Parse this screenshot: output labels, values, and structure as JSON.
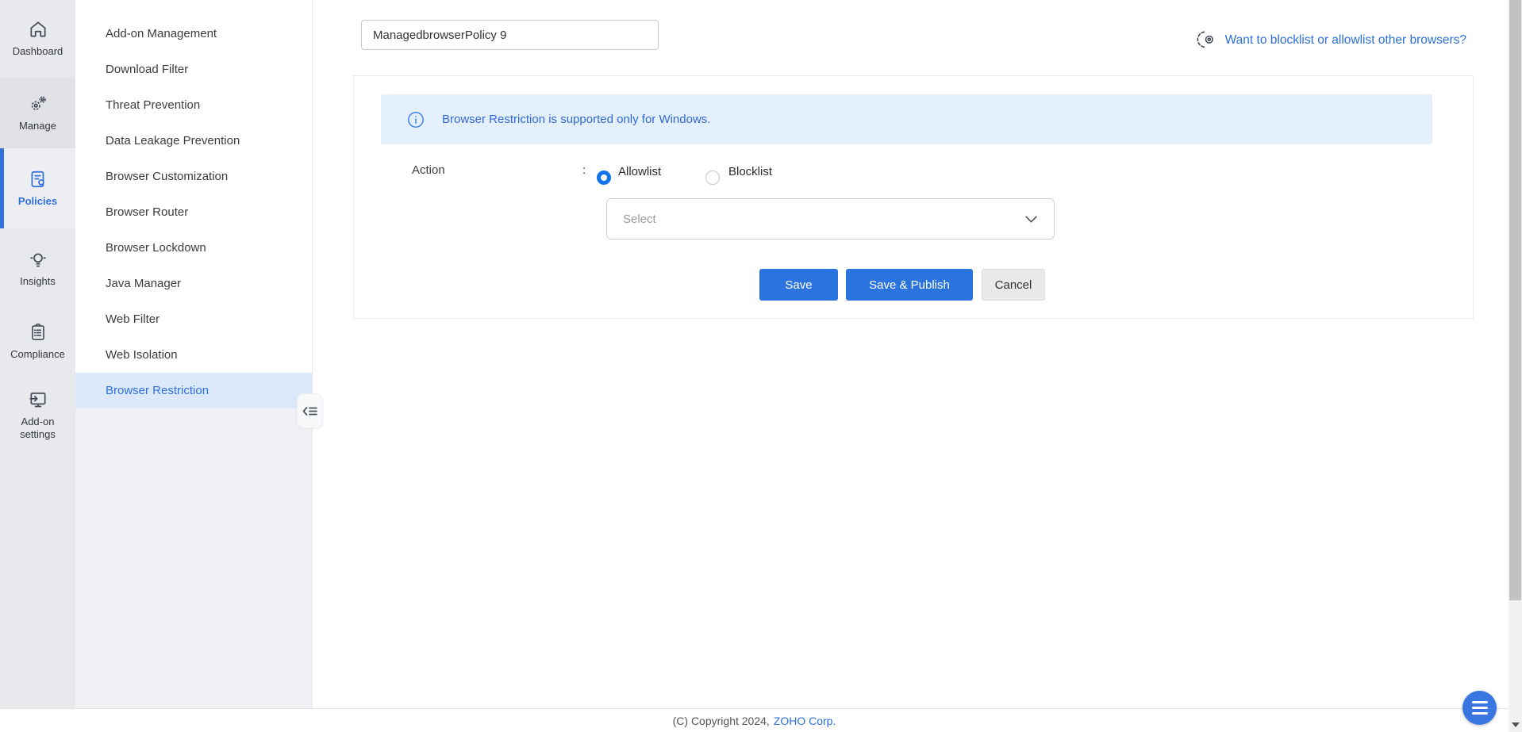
{
  "rail": {
    "active": "Policies",
    "items": [
      {
        "label": "Dashboard",
        "icon": "home-icon"
      },
      {
        "label": "Manage",
        "icon": "gears-icon"
      },
      {
        "label": "Policies",
        "icon": "policy-document-icon"
      },
      {
        "label": "Insights",
        "icon": "lightbulb-icon"
      },
      {
        "label": "Compliance",
        "icon": "clipboard-icon"
      },
      {
        "label": "Add-on settings",
        "icon": "monitor-install-icon"
      }
    ]
  },
  "sidebar": {
    "active": "Browser Restriction",
    "items": [
      {
        "label": "Add-on Management"
      },
      {
        "label": "Download Filter"
      },
      {
        "label": "Threat Prevention"
      },
      {
        "label": "Data Leakage Prevention"
      },
      {
        "label": "Browser Customization"
      },
      {
        "label": "Browser Router"
      },
      {
        "label": "Browser Lockdown"
      },
      {
        "label": "Java Manager"
      },
      {
        "label": "Web Filter"
      },
      {
        "label": "Web Isolation"
      },
      {
        "label": "Browser Restriction"
      }
    ]
  },
  "header": {
    "policy_name_value": "ManagedbrowserPolicy 9",
    "browser_link_label": "Want to blocklist or allowlist other browsers?"
  },
  "panel": {
    "info_text": "Browser Restriction is supported only for Windows.",
    "action_label": "Action",
    "separator": ":",
    "radio_allowlist": "Allowlist",
    "radio_blocklist": "Blocklist",
    "selected_action": "Allowlist",
    "select_placeholder": "Select",
    "save_label": "Save",
    "save_publish_label": "Save & Publish",
    "cancel_label": "Cancel"
  },
  "footer": {
    "copyright_text": "(C) Copyright 2024,",
    "company_link": "ZOHO Corp."
  },
  "colors": {
    "accent_blue": "#2c6fdb",
    "button_blue": "#2b73de",
    "radio_blue": "#1272ec",
    "banner_bg": "#e5f0fd",
    "banner_text": "#3069d6",
    "sidebar_highlight": "#dce9fa",
    "rail_bg": "#e8e9ec"
  }
}
